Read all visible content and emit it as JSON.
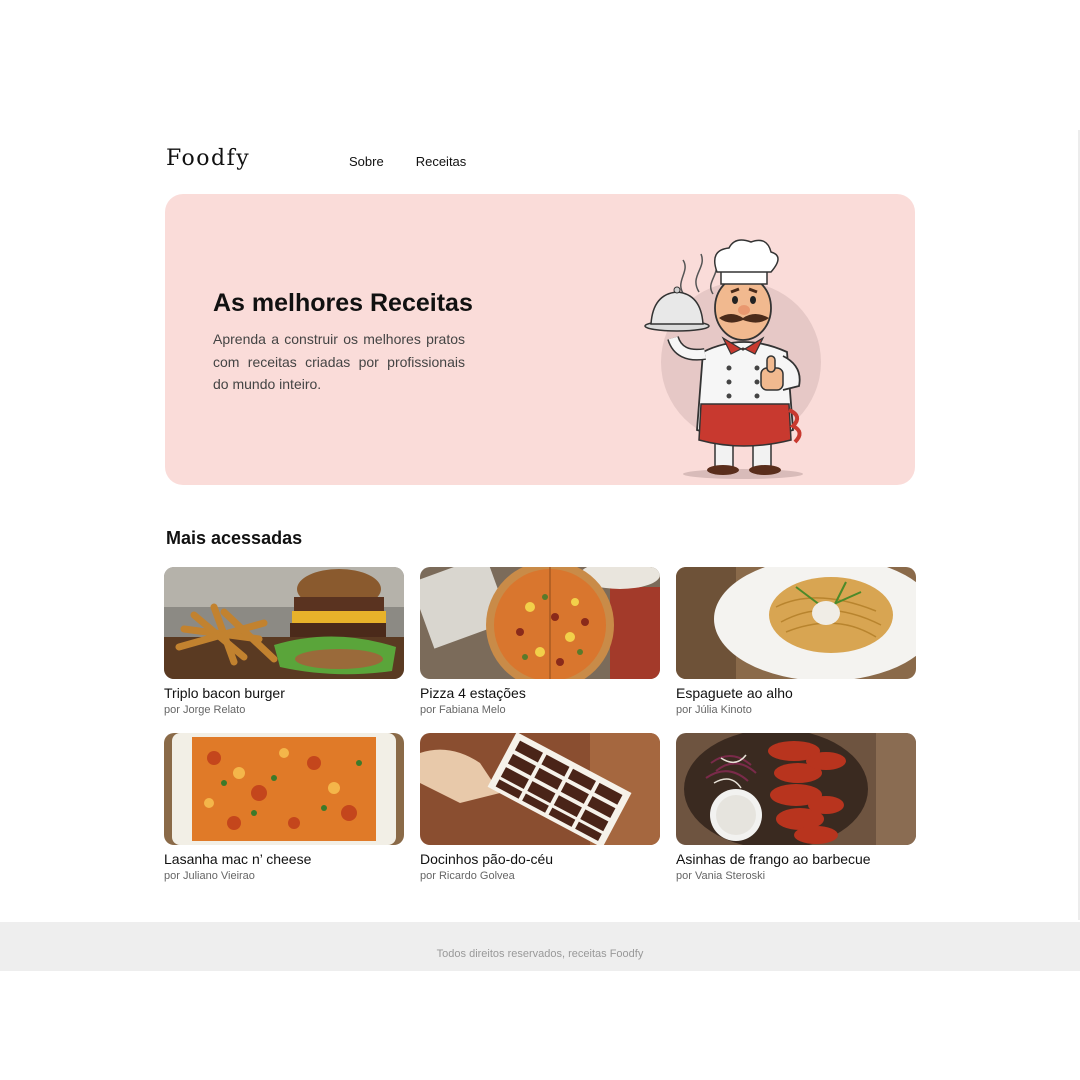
{
  "header": {
    "logo": "Foodfy",
    "nav": [
      {
        "label": "Sobre"
      },
      {
        "label": "Receitas"
      }
    ]
  },
  "hero": {
    "title": "As melhores Receitas",
    "text": "Aprenda a construir os melhores pratos com receitas criadas por profissionais do mundo inteiro.",
    "illustration": "chef-illustration"
  },
  "section": {
    "title": "Mais acessadas"
  },
  "recipes": [
    {
      "title": "Triplo bacon burger",
      "author": "por Jorge Relato",
      "image": "burger-photo"
    },
    {
      "title": "Pizza 4 estações",
      "author": "por Fabiana Melo",
      "image": "pizza-photo"
    },
    {
      "title": "Espaguete ao alho",
      "author": "por Júlia Kinoto",
      "image": "spaghetti-photo"
    },
    {
      "title": "Lasanha mac n’ cheese",
      "author": "por Juliano Vieirao",
      "image": "lasagna-photo"
    },
    {
      "title": "Docinhos pão-do-céu",
      "author": "por Ricardo Golvea",
      "image": "chocolates-photo"
    },
    {
      "title": "Asinhas de frango ao barbecue",
      "author": "por Vania Steroski",
      "image": "chicken-wings-photo"
    }
  ],
  "footer": {
    "text": "Todos direitos reservados, receitas Foodfy"
  },
  "colors": {
    "hero_bg": "#fadcd9",
    "footer_bg": "#eeeeee",
    "text": "#111111",
    "muted": "#666666"
  }
}
